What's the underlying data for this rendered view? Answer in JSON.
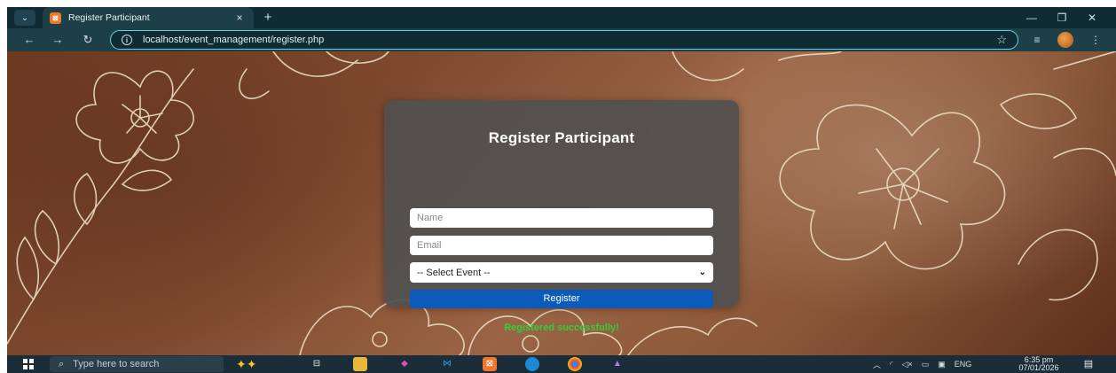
{
  "browser": {
    "tab_title": "Register Participant",
    "tab_close": "×",
    "new_tab": "+",
    "url": "localhost/event_management/register.php",
    "nav": {
      "back": "←",
      "forward": "→",
      "reload": "↻"
    },
    "window_controls": {
      "minimize": "—",
      "maximize": "❐",
      "close": "✕"
    }
  },
  "form": {
    "title": "Register Participant",
    "name_placeholder": "Name",
    "email_placeholder": "Email",
    "event_select_value": "-- Select Event --",
    "submit_label": "Register",
    "success_message": "Registered successfully!"
  },
  "taskbar": {
    "search_placeholder": "Type here to search",
    "language": "ENG",
    "time": "6:35 pm",
    "date": "07/01/2026"
  },
  "colors": {
    "card_bg": "#505050",
    "button_bg": "#0c5bb8",
    "success_text": "#2ed13a",
    "browser_chrome": "#1d3f48",
    "omnibox_border": "#6bd0dc"
  },
  "icons": [
    "tab-search-icon",
    "xampp-favicon-icon",
    "info-icon",
    "star-icon",
    "reading-list-icon",
    "profile-icon",
    "menu-icon",
    "windows-start-icon",
    "search-icon",
    "copilot-icon",
    "task-view-icon",
    "file-explorer-icon",
    "vscode-icon",
    "edge-icon",
    "chrome-icon",
    "notification-icon"
  ]
}
